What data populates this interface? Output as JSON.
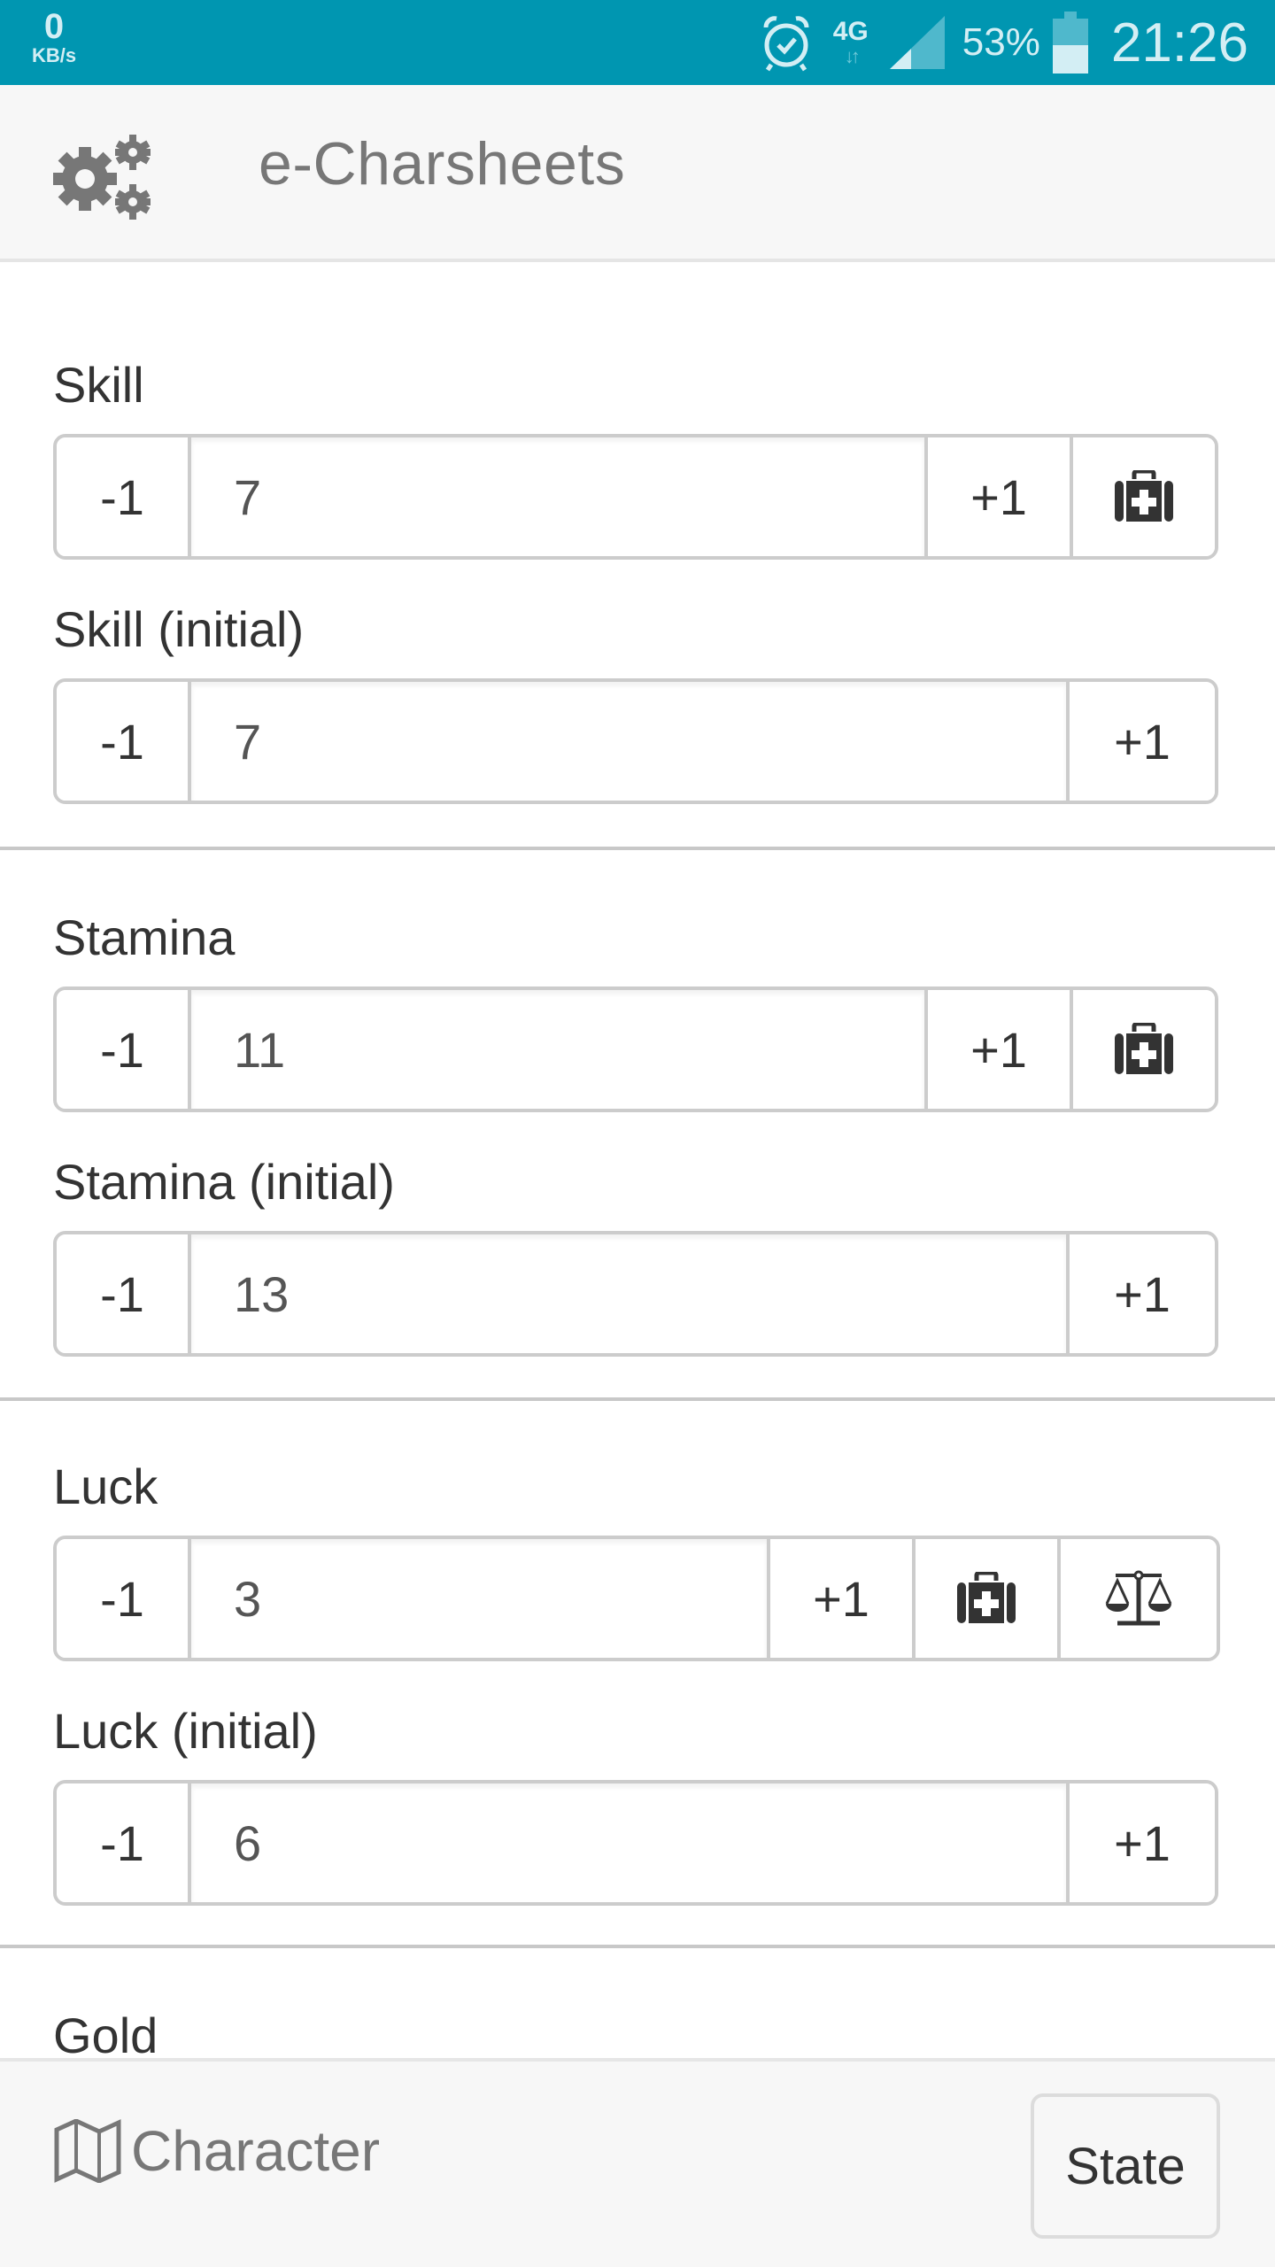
{
  "status_bar": {
    "net_speed_value": "0",
    "net_speed_unit": "KB/s",
    "network_type": "4G",
    "network_arrows": "↓↑",
    "battery_percent": "53%",
    "battery_level": 0.53,
    "time": "21:26",
    "icons": [
      "alarm-icon",
      "signal-icon",
      "battery-icon"
    ],
    "background_color": "#0096b1"
  },
  "header": {
    "menu_icon": "gears-icon",
    "title": "e-Charsheets"
  },
  "stats": [
    {
      "label": "Skill",
      "value": "7",
      "decrement_label": "-1",
      "increment_label": "+1",
      "actions": [
        "first-aid-icon"
      ]
    },
    {
      "label": "Skill (initial)",
      "value": "7",
      "decrement_label": "-1",
      "increment_label": "+1",
      "actions": []
    },
    {
      "label": "Stamina",
      "value": "11",
      "decrement_label": "-1",
      "increment_label": "+1",
      "actions": [
        "first-aid-icon"
      ]
    },
    {
      "label": "Stamina (initial)",
      "value": "13",
      "decrement_label": "-1",
      "increment_label": "+1",
      "actions": []
    },
    {
      "label": "Luck",
      "value": "3",
      "decrement_label": "-1",
      "increment_label": "+1",
      "actions": [
        "first-aid-icon",
        "scales-icon"
      ]
    },
    {
      "label": "Luck (initial)",
      "value": "6",
      "decrement_label": "-1",
      "increment_label": "+1",
      "actions": []
    },
    {
      "label": "Gold"
    }
  ],
  "footer": {
    "character_icon": "map-icon",
    "character_label": "Character",
    "state_button_label": "State"
  }
}
